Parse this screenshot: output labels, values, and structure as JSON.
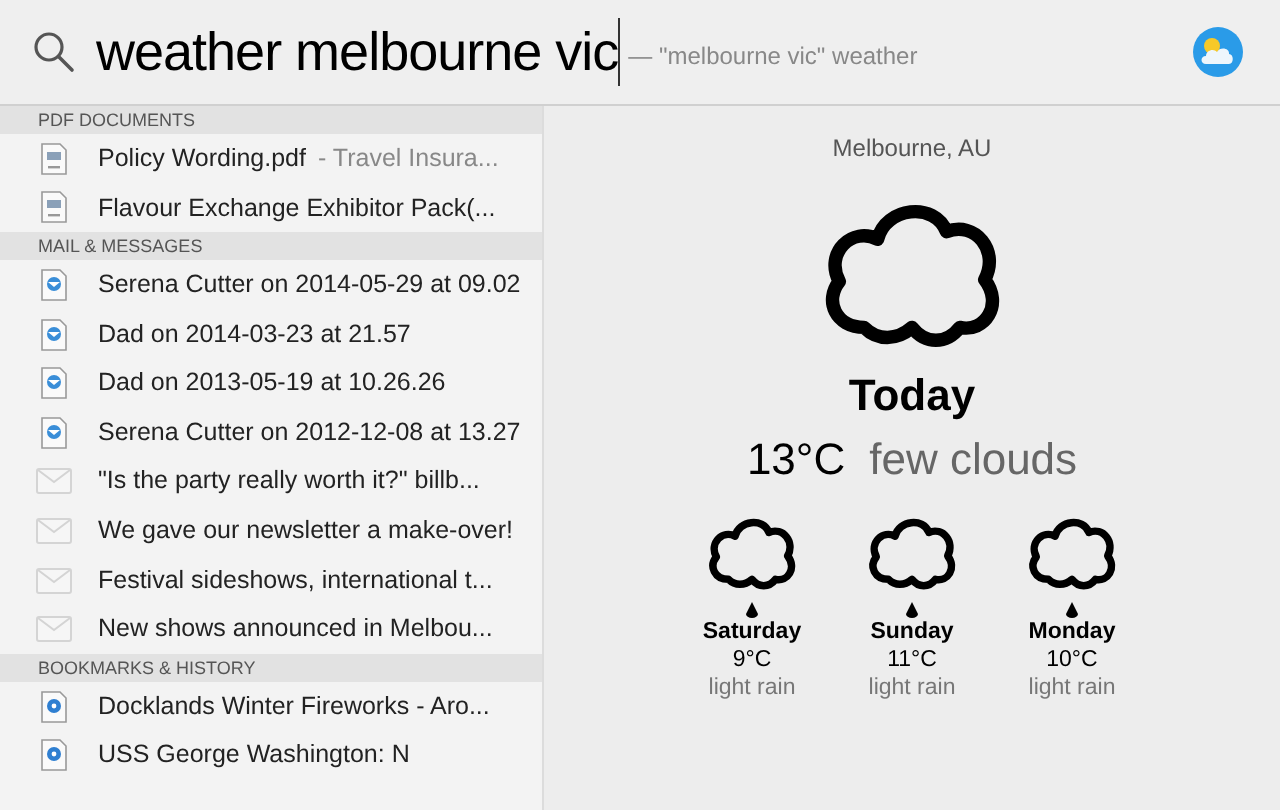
{
  "search": {
    "query": "weather melbourne vic",
    "suggestion": "— \"melbourne vic\" weather"
  },
  "sections": [
    {
      "title": "PDF DOCUMENTS",
      "items": [
        {
          "kind": "pdf",
          "title": "Policy Wording.pdf",
          "detail": "- Travel Insura..."
        },
        {
          "kind": "pdf",
          "title": "Flavour Exchange Exhibitor Pack(..."
        }
      ]
    },
    {
      "title": "MAIL & MESSAGES",
      "items": [
        {
          "kind": "mail",
          "title": "Serena Cutter on 2014-05-29 at 09.02"
        },
        {
          "kind": "mail",
          "title": "Dad on 2014-03-23 at 21.57"
        },
        {
          "kind": "mail",
          "title": "Dad on 2013-05-19 at 10.26.26"
        },
        {
          "kind": "mail",
          "title": "Serena Cutter on 2012-12-08 at 13.27"
        },
        {
          "kind": "message",
          "title": "\"Is the party really worth it?\" billb..."
        },
        {
          "kind": "message",
          "title": "We gave our newsletter a make-over!"
        },
        {
          "kind": "message",
          "title": "Festival sideshows, international t..."
        },
        {
          "kind": "message",
          "title": "New shows announced in Melbou..."
        }
      ]
    },
    {
      "title": "BOOKMARKS & HISTORY",
      "items": [
        {
          "kind": "bookmark",
          "title": "Docklands Winter Fireworks - Aro..."
        },
        {
          "kind": "bookmark",
          "title": "USS George Washington: N"
        }
      ]
    }
  ],
  "weather": {
    "location": "Melbourne, AU",
    "day": "Today",
    "temperature": "13°C",
    "condition": "few clouds",
    "forecast": [
      {
        "day": "Saturday",
        "temperature": "9°C",
        "condition": "light rain"
      },
      {
        "day": "Sunday",
        "temperature": "11°C",
        "condition": "light rain"
      },
      {
        "day": "Monday",
        "temperature": "10°C",
        "condition": "light rain"
      }
    ]
  }
}
